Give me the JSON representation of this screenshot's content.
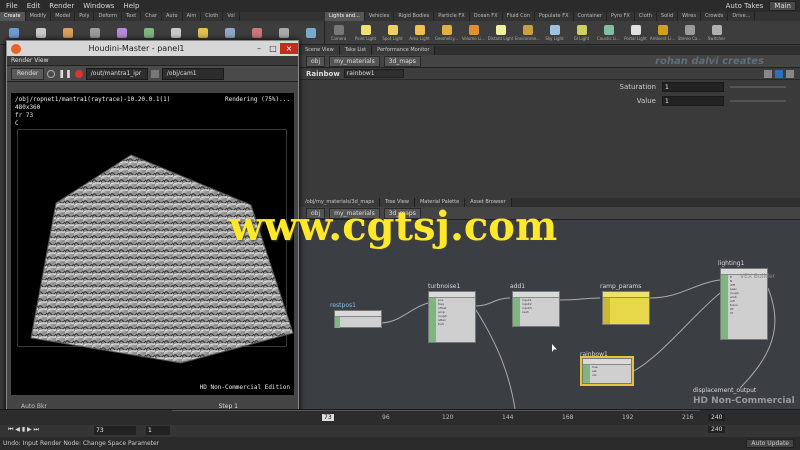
{
  "menu": [
    "File",
    "Edit",
    "Render",
    "Windows",
    "Help"
  ],
  "menu_right": {
    "auto_takes": "Auto Takes",
    "desktop": "Main"
  },
  "shelf_tabs_left": [
    "Create",
    "Modify",
    "Model",
    "Poly",
    "Deform",
    "Text",
    "Char",
    "Auto",
    "Aim",
    "Cloth",
    "Vol"
  ],
  "shelf_tabs_right": [
    "Lights and...",
    "Vehicles",
    "Rigid Bodies",
    "Particle FX",
    "Ocean FX",
    "Fluid Con",
    "Populate FX",
    "Container",
    "Pyro FX",
    "Cloth",
    "Solid",
    "Wires",
    "Crowds",
    "Drive..."
  ],
  "shelf_tools_left": [
    {
      "label": "",
      "color": "#6a9bd1"
    },
    {
      "label": "",
      "color": "#c9c9c9"
    },
    {
      "label": "",
      "color": "#d8a05a"
    },
    {
      "label": "",
      "color": "#9c9c9c"
    },
    {
      "label": "",
      "color": "#b88ad6"
    },
    {
      "label": "",
      "color": "#7fb57f"
    },
    {
      "label": "",
      "color": "#c9c9c9"
    },
    {
      "label": "",
      "color": "#e0c050"
    },
    {
      "label": "",
      "color": "#8fa8c8"
    },
    {
      "label": "",
      "color": "#c77"
    },
    {
      "label": "",
      "color": "#aaa"
    },
    {
      "label": "",
      "color": "#7ac"
    }
  ],
  "shelf_tools_right": [
    {
      "label": "Camera",
      "color": "#777"
    },
    {
      "label": "Point Light",
      "color": "#f0e070"
    },
    {
      "label": "Spot Light",
      "color": "#f0d060"
    },
    {
      "label": "Area Light",
      "color": "#f0c050"
    },
    {
      "label": "Geometry...",
      "color": "#e0b040"
    },
    {
      "label": "Volume Li...",
      "color": "#e09030"
    },
    {
      "label": "Distant Light",
      "color": "#f0f0a0"
    },
    {
      "label": "Environme...",
      "color": "#c9a040"
    },
    {
      "label": "Sky Light",
      "color": "#a0c0e0"
    },
    {
      "label": "GI Light",
      "color": "#d0d060"
    },
    {
      "label": "Caustic Li...",
      "color": "#80c0a0"
    },
    {
      "label": "Portal Light",
      "color": "#e0e0e0"
    },
    {
      "label": "Ambient Li...",
      "color": "#d0a020"
    },
    {
      "label": "Stereo Ca...",
      "color": "#9a9a9a"
    },
    {
      "label": "Switcher",
      "color": "#b0b0b0"
    }
  ],
  "render_view": {
    "window_title": "Houdini-Master - panel1",
    "pane_tab": "Render View",
    "render_button": "Render",
    "output_select": "/out/mantra1_ipr",
    "camera_select": "/obj/cam1",
    "status_path": "/obj/ropnet1/mantra1(raytrace)-10.20.0.1(1)",
    "status_progress": "Rendering (75%)...",
    "resolution": "480x360",
    "frame": "fr 73",
    "channel": "C",
    "license": "HD Non-Commercial Edition",
    "auto_label": "Auto Bkr",
    "step_label": "Step 1"
  },
  "top_panel": {
    "tabs": [
      "Scene View",
      "Take List",
      "Performance Monitor"
    ],
    "path": [
      "obj",
      "my_materials",
      "3d_maps"
    ],
    "brand": "rohan dalvi creates",
    "node_type": "Rainbow",
    "node_name": "rainbow1",
    "params": [
      {
        "label": "Saturation",
        "value": "1"
      },
      {
        "label": "Value",
        "value": "1"
      }
    ]
  },
  "network": {
    "tabs": [
      "/obj/my_materials/3d_maps",
      "Tree View",
      "Material Palette",
      "Asset Browser"
    ],
    "path": [
      "obj",
      "my_materials",
      "3d_maps"
    ],
    "nodes": [
      {
        "label": "restpos1",
        "color": "#7fbfe8"
      },
      {
        "label": "turbnoise1",
        "color": "#dcdcdc"
      },
      {
        "label": "add1",
        "color": "#dcdcdc"
      },
      {
        "label": "ramp_params",
        "color": "#dcdcdc"
      },
      {
        "label": "rainbow1",
        "color": "#dcdcdc"
      },
      {
        "label": "lighting1",
        "color": "#dcdcdc"
      },
      {
        "label": "displacement_output",
        "color": "#dcdcdc"
      }
    ],
    "overlay_label": "HD Non-Commercial",
    "overlay_tag": "VEX Builder"
  },
  "timeline": {
    "current_frame": "73",
    "start": "1",
    "ticks": [
      "73",
      "96",
      "120",
      "144",
      "168",
      "192",
      "216"
    ],
    "end_frame": "240",
    "end_frame2": "240"
  },
  "status": {
    "message": "Undo: Input Render Node: Change Space Parameter",
    "auto_update": "Auto Update"
  },
  "watermark": "www.cgtsj.com"
}
